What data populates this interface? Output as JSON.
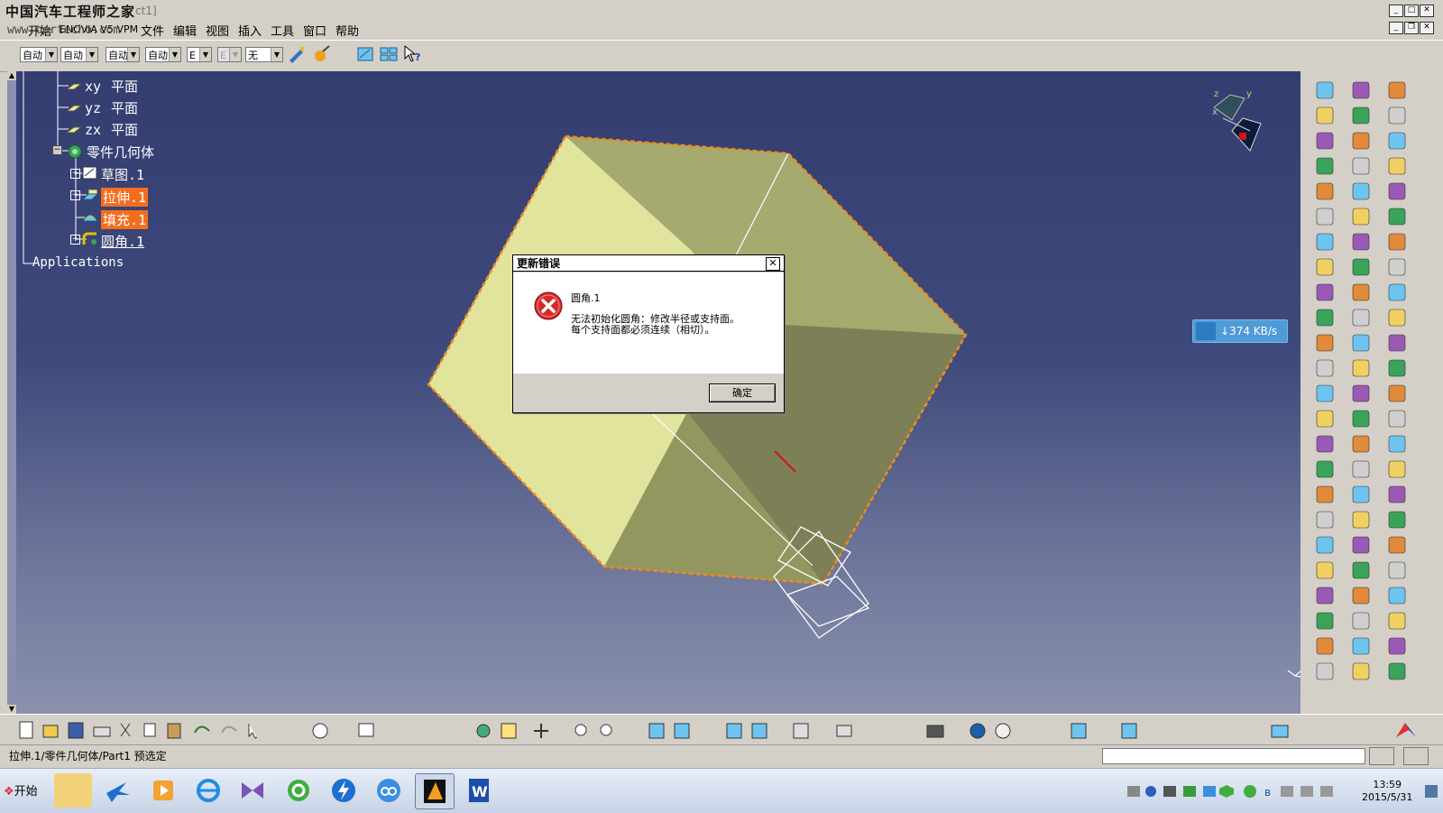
{
  "window": {
    "title_fragment": "ct1]",
    "watermark_cn": "中国汽车工程师之家",
    "watermark_url": "www.cartecho.com"
  },
  "menu": [
    "开始",
    "ENOVIA V5 VPM",
    "文件",
    "编辑",
    "视图",
    "插入",
    "工具",
    "窗口",
    "帮助"
  ],
  "toolbar": {
    "combos": [
      "自动",
      "自动",
      "自动",
      "自动",
      "E",
      "E",
      "无"
    ]
  },
  "tree": {
    "items": [
      {
        "prefix": "xy",
        "label": "平面"
      },
      {
        "prefix": "yz",
        "label": "平面"
      },
      {
        "prefix": "zx",
        "label": "平面"
      }
    ],
    "body": "零件几何体",
    "features": [
      "草图.1",
      "拉伸.1",
      "填充.1",
      "圆角.1"
    ],
    "applications": "Applications"
  },
  "dialog": {
    "title": "更新错误",
    "feature": "圆角.1",
    "line1": "无法初始化圆角：修改半径或支持面。",
    "line2": "每个支持面都必须连续（相切）。",
    "ok": "确定",
    "close": "✕"
  },
  "speed_badge": {
    "value": "↓374 KB/s"
  },
  "compass_labels": [
    "z",
    "y",
    "x"
  ],
  "status": {
    "text": "拉伸.1/零件几何体/Part1 预选定"
  },
  "taskbar": {
    "start": "开始",
    "time": "13:59",
    "date": "2015/5/31"
  },
  "colors": {
    "highlight": "#f26e1f",
    "viewport_top": "#333d70",
    "viewport_bottom": "#8a90ad",
    "error_red": "#d42a2a"
  }
}
